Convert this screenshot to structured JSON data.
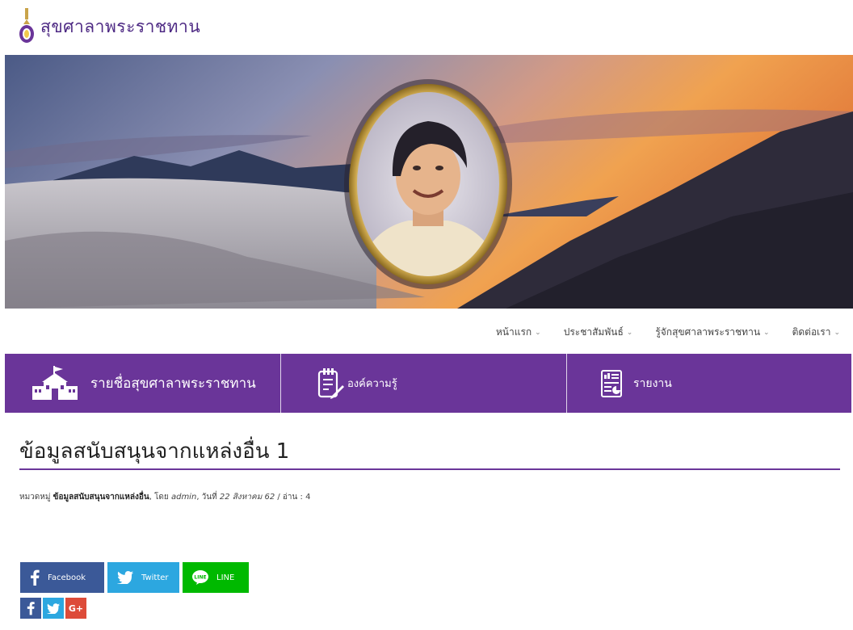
{
  "site": {
    "logo_text": "สุขศาลาพระราชทาน"
  },
  "nav": {
    "items": [
      {
        "label": "หน้าแรก"
      },
      {
        "label": "ประชาสัมพันธ์"
      },
      {
        "label": "รู้จักสุขศาลาพระราชทาน"
      },
      {
        "label": "ติดต่อเรา"
      }
    ]
  },
  "quickbar": {
    "items": [
      {
        "label": "รายชื่อสุขศาลาพระราชทาน",
        "icon": "school-building-icon"
      },
      {
        "label": "องค์ความรู้",
        "icon": "notepad-pencil-icon"
      },
      {
        "label": "รายงาน",
        "icon": "report-chart-icon"
      }
    ]
  },
  "article": {
    "title": "ข้อมูลสนับสนุนจากแหล่งอื่น 1",
    "meta": {
      "category_prefix": "หมวดหมู่ ",
      "category": "ข้อมูลสนับสนุนจากแหล่งอื่น",
      "by_prefix": ", โดย ",
      "author": "admin",
      "date_prefix": ", วันที่ ",
      "date": "22 สิงหาคม 62",
      "reads_prefix": " / อ่าน : ",
      "reads": "4"
    }
  },
  "share": {
    "facebook_label": "Facebook",
    "twitter_label": "Twitter",
    "line_label": "LINE",
    "mini_google_label": "G+"
  },
  "colors": {
    "brand_purple": "#6a3599",
    "facebook": "#3b5998",
    "twitter": "#2ca7e0",
    "line": "#00b900",
    "google": "#dd4b39"
  }
}
